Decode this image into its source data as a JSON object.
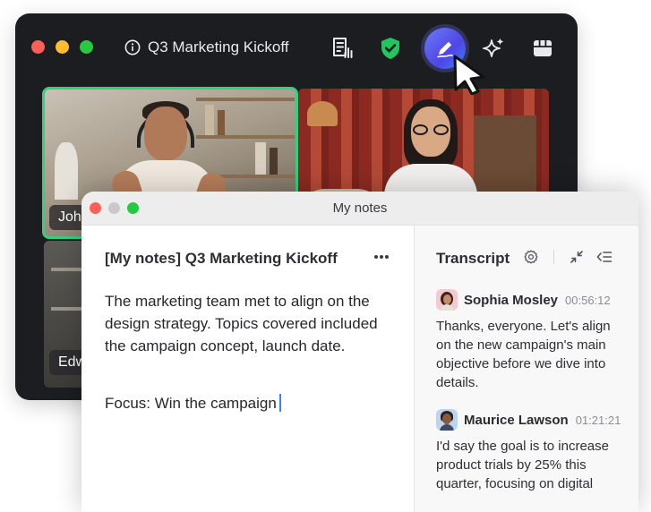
{
  "meeting": {
    "title": "Q3 Marketing Kickoff",
    "participants": [
      {
        "name_partial": "Joh"
      },
      {
        "name_partial": ""
      },
      {
        "name_partial": "Edw"
      }
    ]
  },
  "icons": {
    "info": "info-icon",
    "transcript": "transcript-doc-icon",
    "security": "shield-check-icon",
    "notes": "pen-icon",
    "ai": "sparkle-icon",
    "apps": "apps-grid-icon"
  },
  "colors": {
    "active_speaker_border": "#35d07f",
    "accent": "#4f46e5",
    "shield": "#22c55e"
  },
  "notes_window": {
    "title": "My notes",
    "heading": "[My notes] Q3 Marketing Kickoff",
    "body": "The marketing team met to align on the design strategy. Topics covered included the campaign concept, launch date.",
    "focus_line": "Focus: Win the campaign"
  },
  "transcript": {
    "heading": "Transcript",
    "entries": [
      {
        "speaker": "Sophia Mosley",
        "time": "00:56:12",
        "text": "Thanks, everyone. Let's align on the new campaign's main objective before we dive into details."
      },
      {
        "speaker": "Maurice Lawson",
        "time": "01:21:21",
        "text": "I'd say the goal is to increase product trials by 25% this quarter, focusing on digital"
      }
    ]
  }
}
